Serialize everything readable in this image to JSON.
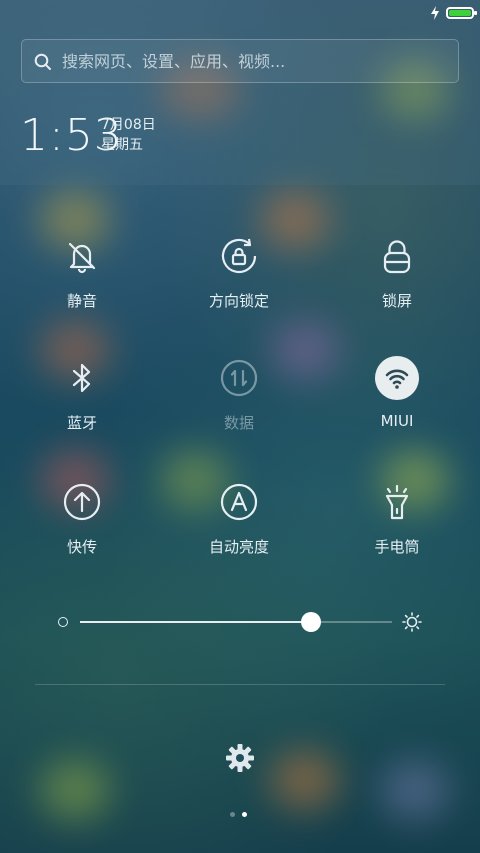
{
  "status": {
    "battery_level": 1.0,
    "charging_icon": "lightning-icon",
    "battery_color": "#3fd13c"
  },
  "search": {
    "placeholder": "搜索网页、设置、应用、视频..."
  },
  "clock": {
    "time": "1:53",
    "date": "7月08日",
    "weekday": "星期五"
  },
  "toggles": [
    {
      "label": "静音",
      "icon": "mute-bell-icon",
      "state": "off"
    },
    {
      "label": "方向锁定",
      "icon": "rotation-lock-icon",
      "state": "off"
    },
    {
      "label": "锁屏",
      "icon": "lock-icon",
      "state": "off"
    },
    {
      "label": "蓝牙",
      "icon": "bluetooth-icon",
      "state": "off"
    },
    {
      "label": "数据",
      "icon": "mobile-data-icon",
      "state": "disabled"
    },
    {
      "label": "MIUI",
      "icon": "wifi-icon",
      "state": "on"
    },
    {
      "label": "快传",
      "icon": "quick-transfer-icon",
      "state": "off"
    },
    {
      "label": "自动亮度",
      "icon": "auto-brightness-icon",
      "state": "off"
    },
    {
      "label": "手电筒",
      "icon": "flashlight-icon",
      "state": "off"
    }
  ],
  "brightness": {
    "level": 0.74,
    "low_icon": "brightness-low-icon",
    "high_icon": "brightness-high-icon"
  },
  "settings": {
    "icon": "settings-gear-icon"
  },
  "pager": {
    "count": 2,
    "active": 1
  },
  "colors": {
    "accent_on": "#e8edef",
    "text": "#e6eef2"
  }
}
